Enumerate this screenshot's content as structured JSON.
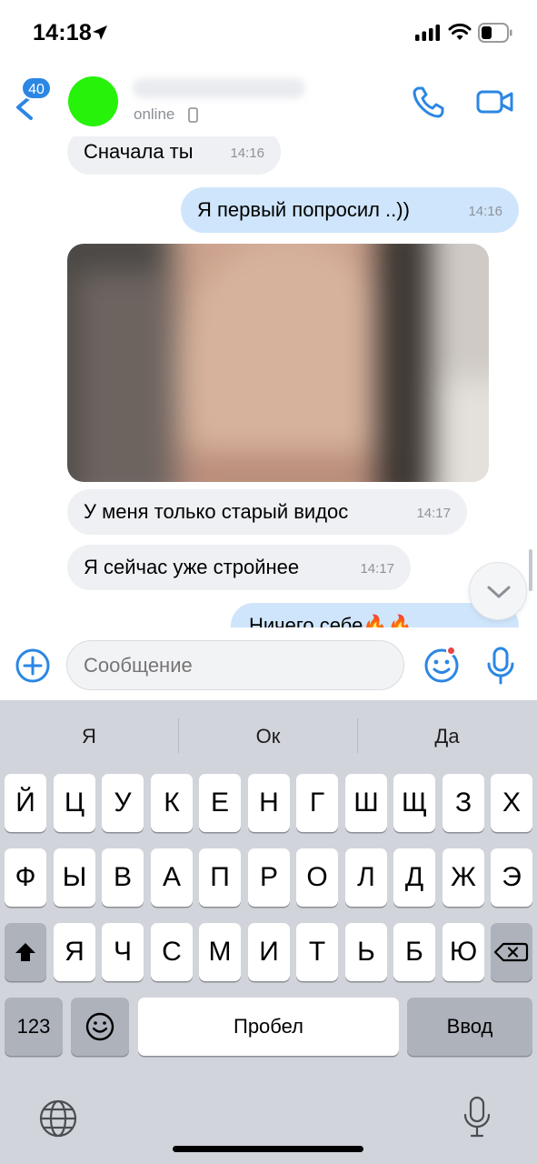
{
  "status_bar": {
    "time": "14:18"
  },
  "header": {
    "back_badge": "40",
    "status": "online",
    "colors": {
      "accent": "#2b87e3",
      "avatar": "#26f20a"
    }
  },
  "messages": [
    {
      "direction": "in",
      "text": "Сначала ты",
      "time": "14:16"
    },
    {
      "direction": "out",
      "text": "Я первый попросил ..))",
      "time": "14:16"
    },
    {
      "direction": "in",
      "type": "video",
      "blurred": true
    },
    {
      "direction": "in",
      "text": "У меня только старый видос",
      "time": "14:17"
    },
    {
      "direction": "in",
      "text": "Я сейчас уже стройнее",
      "time": "14:17"
    },
    {
      "direction": "out",
      "text": "Ничего себе🔥🔥",
      "partial": true
    }
  ],
  "composer": {
    "placeholder": "Сообщение"
  },
  "keyboard": {
    "suggestions": [
      "Я",
      "Ок",
      "Да"
    ],
    "row1": [
      "Й",
      "Ц",
      "У",
      "К",
      "Е",
      "Н",
      "Г",
      "Ш",
      "Щ",
      "З",
      "Х"
    ],
    "row2": [
      "Ф",
      "Ы",
      "В",
      "А",
      "П",
      "Р",
      "О",
      "Л",
      "Д",
      "Ж",
      "Э"
    ],
    "row3": [
      "Я",
      "Ч",
      "С",
      "М",
      "И",
      "Т",
      "Ь",
      "Б",
      "Ю"
    ],
    "numbers_key": "123",
    "space_key": "Пробел",
    "return_key": "Ввод"
  }
}
